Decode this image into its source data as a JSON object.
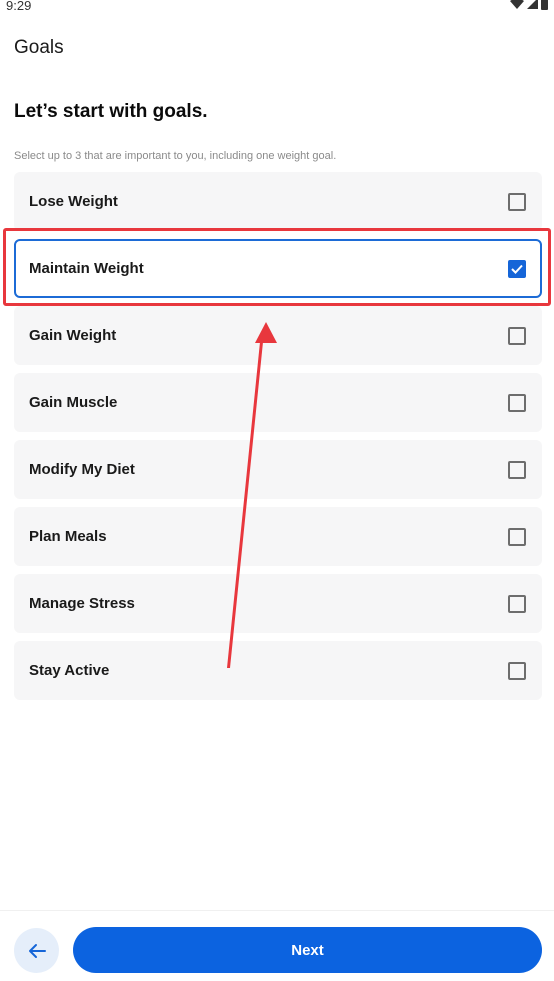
{
  "status_bar": {
    "time": "9:29"
  },
  "header": {
    "title": "Goals"
  },
  "intro": {
    "headline": "Let’s start with goals.",
    "subtext": "Select up to 3 that are important to you, including one weight goal."
  },
  "goals": [
    {
      "label": "Lose Weight",
      "checked": false
    },
    {
      "label": "Maintain Weight",
      "checked": true
    },
    {
      "label": "Gain Weight",
      "checked": false
    },
    {
      "label": "Gain Muscle",
      "checked": false
    },
    {
      "label": "Modify My Diet",
      "checked": false
    },
    {
      "label": "Plan Meals",
      "checked": false
    },
    {
      "label": "Manage Stress",
      "checked": false
    },
    {
      "label": "Stay Active",
      "checked": false
    }
  ],
  "footer": {
    "next_label": "Next"
  },
  "colors": {
    "accent": "#0c63e0",
    "annotation": "#e8373d",
    "item_background": "#f6f6f7"
  },
  "icons": {
    "back": "arrow-left-icon",
    "wifi": "wifi-icon",
    "signal": "signal-icon",
    "battery": "battery-icon",
    "check": "checkmark-icon"
  }
}
